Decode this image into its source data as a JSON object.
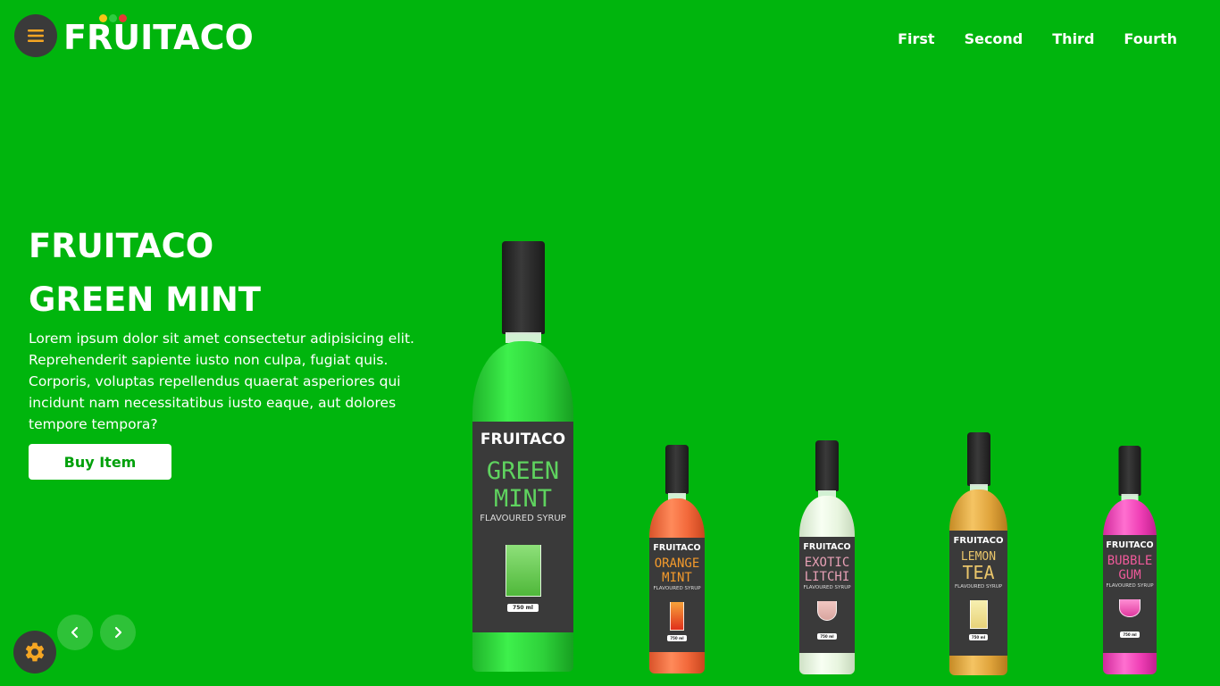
{
  "header": {
    "logo_text": "FRUITACO",
    "nav": [
      "First",
      "Second",
      "Third",
      "Fourth"
    ]
  },
  "hero": {
    "title_line1": "FRUITACO",
    "title_line2": "GREEN MINT",
    "description": "Lorem ipsum dolor sit amet consectetur adipisicing elit. Reprehenderit sapiente iusto non culpa, fugiat quis. Corporis, voluptas repellendus quaerat asperiores qui incidunt nam necessitatibus iusto eaque, aut dolores tempore tempora?",
    "buy_label": "Buy Item"
  },
  "colors": {
    "background": "#00b50d",
    "button_dark": "#3a3a3a",
    "menu_icon": "#f5a623",
    "settings_icon": "#f5a623"
  },
  "icons": {
    "menu": "hamburger-icon",
    "settings": "gear-icon",
    "prev": "chevron-left-icon",
    "next": "chevron-right-icon"
  },
  "products": [
    {
      "brand": "FRUITACO",
      "flavor_line1": "GREEN",
      "flavor_line2": "MINT",
      "subtitle": "FLAVOURED SYRUP",
      "volume": "750 ml",
      "liquid_color": "#2ed13a",
      "flavor_color": "#5fd35f"
    },
    {
      "brand": "FRUITACO",
      "flavor_line1": "ORANGE",
      "flavor_line2": "MINT",
      "subtitle": "FLAVOURED SYRUP",
      "volume": "750 ml",
      "liquid_color": "#f2683a",
      "flavor_color": "#f39a2c"
    },
    {
      "brand": "FRUITACO",
      "flavor_line1": "EXOTIC",
      "flavor_line2": "LITCHI",
      "subtitle": "FLAVOURED SYRUP",
      "volume": "750 ml",
      "liquid_color": "#e8f5df",
      "flavor_color": "#e7a0b5"
    },
    {
      "brand": "FRUITACO",
      "flavor_line1": "LEMON",
      "flavor_line2": "TEA",
      "subtitle": "FLAVOURED SYRUP",
      "volume": "750 ml",
      "liquid_color": "#e0a43c",
      "flavor_color": "#e9c56a"
    },
    {
      "brand": "FRUITACO",
      "flavor_line1": "BUBBLE",
      "flavor_line2": "GUM",
      "subtitle": "FLAVOURED SYRUP",
      "volume": "750 ml",
      "liquid_color": "#ef3fb5",
      "flavor_color": "#ef5a9a"
    }
  ]
}
